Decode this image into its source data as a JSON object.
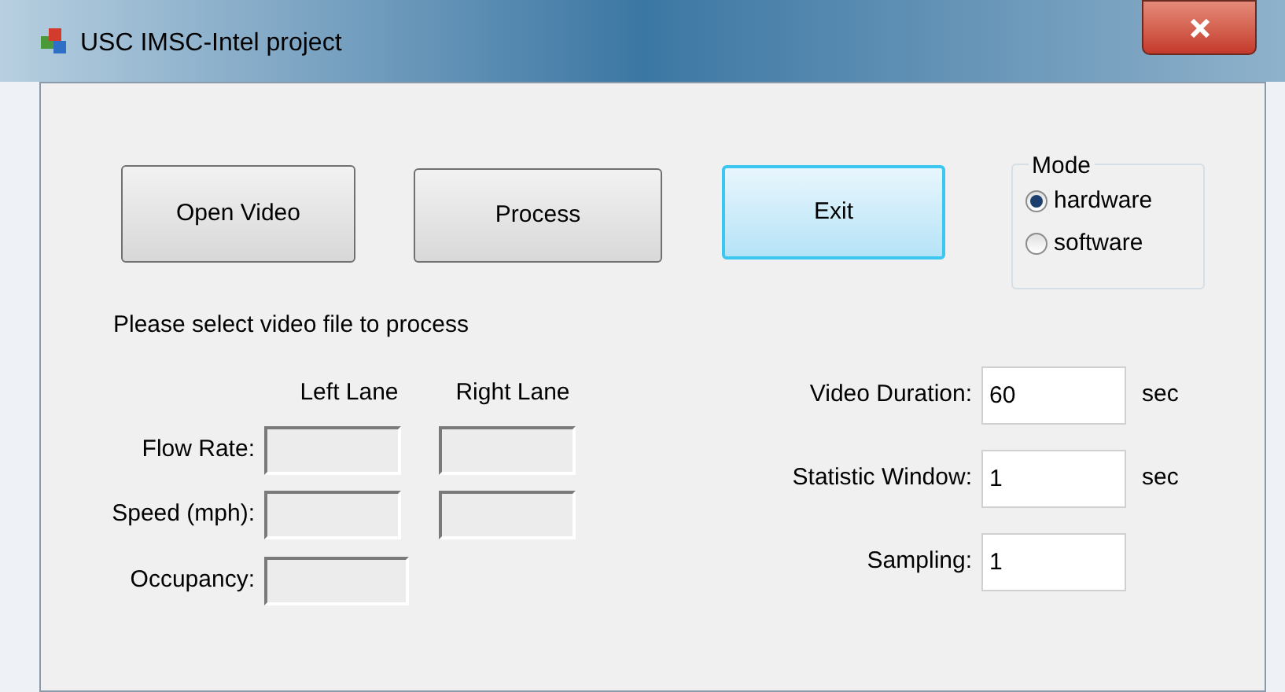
{
  "window": {
    "title": "USC IMSC-Intel project"
  },
  "buttons": [
    {
      "label": "Open Video",
      "focused": false
    },
    {
      "label": "Process",
      "focused": false
    },
    {
      "label": "Exit",
      "focused": true
    }
  ],
  "mode": {
    "title": "Mode",
    "options": [
      {
        "label": "hardware",
        "selected": true
      },
      {
        "label": "software",
        "selected": false
      }
    ]
  },
  "status_text": "Please select video file to process",
  "lanes": {
    "columns": [
      "Left Lane",
      "Right Lane"
    ],
    "rows": [
      {
        "label": "Flow Rate:",
        "kind": "per_lane"
      },
      {
        "label": "Speed (mph):",
        "kind": "per_lane"
      },
      {
        "label": "Occupancy:",
        "kind": "combined"
      }
    ]
  },
  "settings": [
    {
      "label": "Video Duration:",
      "value": "60",
      "unit": "sec"
    },
    {
      "label": "Statistic Window:",
      "value": "1",
      "unit": "sec"
    },
    {
      "label": "Sampling:",
      "value": "1"
    }
  ]
}
